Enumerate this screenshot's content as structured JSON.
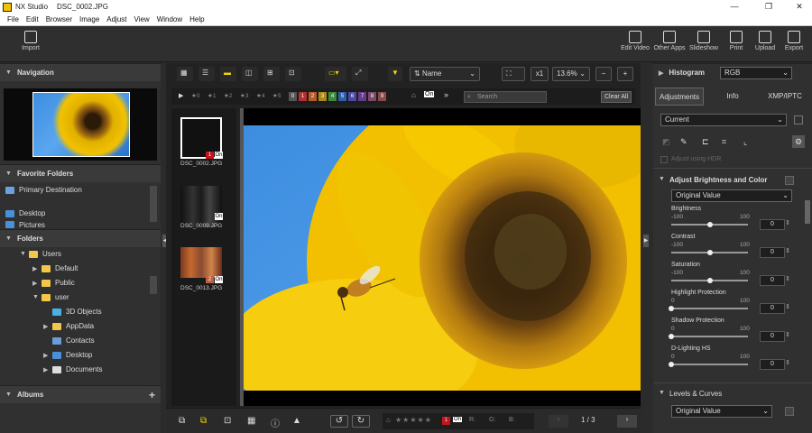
{
  "window": {
    "app": "NX Studio",
    "file": "DSC_0002.JPG",
    "min": "—",
    "restore": "❐",
    "close": "✕"
  },
  "menu": [
    "File",
    "Edit",
    "Browser",
    "Image",
    "Adjust",
    "View",
    "Window",
    "Help"
  ],
  "toolbar": {
    "import": "Import",
    "edit_video": "Edit Video",
    "other_apps": "Other Apps",
    "slideshow": "Slideshow",
    "print": "Print",
    "upload": "Upload",
    "export": "Export"
  },
  "left": {
    "navigation": "Navigation",
    "favorite_folders": "Favorite Folders",
    "favorites": [
      "Primary Destination",
      "Desktop",
      "Pictures"
    ],
    "folders": "Folders",
    "tree": [
      "Users",
      "Default",
      "Public",
      "user",
      "3D Objects",
      "AppData",
      "Contacts",
      "Desktop",
      "Documents"
    ],
    "albums": "Albums"
  },
  "center": {
    "sort": "Name",
    "zoom_x": "x1",
    "zoom_pct": "13.6%",
    "search_placeholder": "Search",
    "clear_all": "Clear All",
    "stars": [
      "★0",
      "★1",
      "★2",
      "★3",
      "★4",
      "★5"
    ],
    "labels": [
      "0",
      "1",
      "2",
      "3",
      "4",
      "5",
      "6",
      "7",
      "8",
      "9"
    ],
    "label_colors": [
      "#555",
      "#b23030",
      "#b85a2a",
      "#a88a1a",
      "#3c8a3c",
      "#2f5fa8",
      "#4a4aa0",
      "#6a3a8a",
      "#7a4a6a",
      "#8a4a4a"
    ],
    "thumbs": [
      {
        "name": "DSC_0002.JPG",
        "badge": "1"
      },
      {
        "name": "DSC_0009.JPG",
        "badge": ""
      },
      {
        "name": "DSC_0013.JPG",
        "badge": "2"
      }
    ],
    "page": "1 / 3",
    "r": "R:",
    "g": "G:",
    "b": "B:"
  },
  "right": {
    "histogram": "Histogram",
    "hist_mode": "RGB",
    "tabs": [
      "Adjustments",
      "Info",
      "XMP/IPTC"
    ],
    "current": "Current",
    "adjust_hdr": "Adjust using HDR",
    "section": "Adjust Brightness and Color",
    "preset": "Original Value",
    "sliders": [
      {
        "label": "Brightness",
        "min": "-100",
        "max": "100",
        "value": "0",
        "pos": 0.5
      },
      {
        "label": "Contrast",
        "min": "-100",
        "max": "100",
        "value": "0",
        "pos": 0.5
      },
      {
        "label": "Saturation",
        "min": "-100",
        "max": "100",
        "value": "0",
        "pos": 0.5
      },
      {
        "label": "Highlight Protection",
        "min": "0",
        "max": "100",
        "value": "0",
        "pos": 0
      },
      {
        "label": "Shadow Protection",
        "min": "0",
        "max": "100",
        "value": "0",
        "pos": 0
      },
      {
        "label": "D-Lighting HS",
        "min": "0",
        "max": "100",
        "value": "0",
        "pos": 0
      }
    ],
    "levels": "Levels & Curves",
    "levels_preset": "Original Value"
  }
}
